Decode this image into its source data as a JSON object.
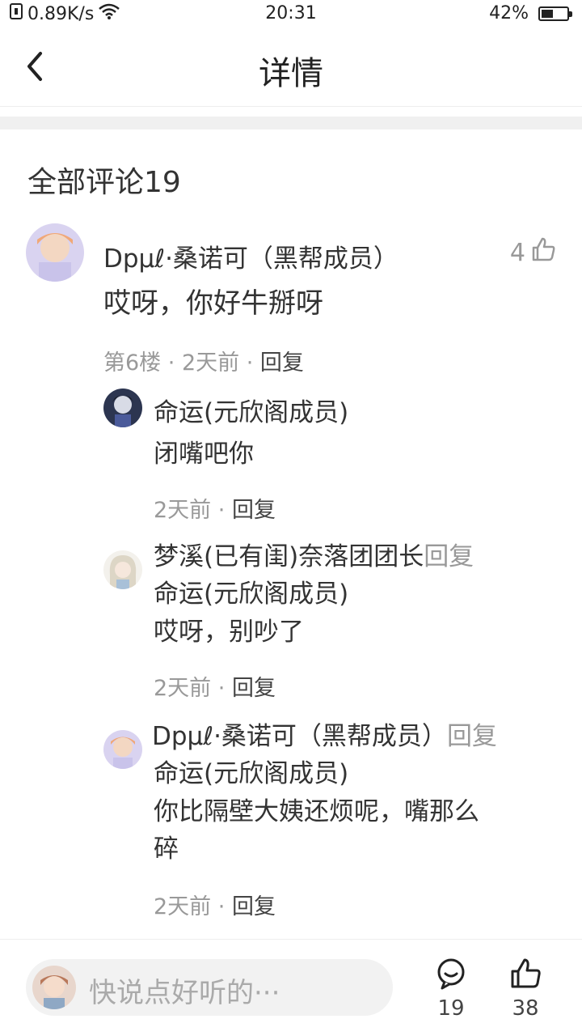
{
  "status_bar": {
    "net_speed": "0.89K/s",
    "time": "20:31",
    "battery": "42%",
    "battery_level": 0.42
  },
  "nav": {
    "title": "详情"
  },
  "section": {
    "title": "全部评论19"
  },
  "main_comment": {
    "author": "Dpμℓ·桑诺可（黑帮成员）",
    "likes": "4",
    "text": "哎呀，你好牛掰呀",
    "floor": "第6楼",
    "time": "2天前",
    "reply_label": "回复"
  },
  "replies": [
    {
      "author": "命运(元欣阁成员)",
      "text": "闭嘴吧你",
      "time": "2天前",
      "reply_label": "回复"
    },
    {
      "author": "梦溪(已有闺)奈落团团长",
      "reply_word": "回复",
      "target": "命运(元欣阁成员)",
      "text": "哎呀，别吵了",
      "time": "2天前",
      "reply_label": "回复"
    },
    {
      "author": "Dpμℓ·桑诺可（黑帮成员）",
      "reply_word": "回复",
      "target": "命运(元欣阁成员)",
      "text_line1": "你比隔壁大姨还烦呢，嘴那么",
      "text_line2": "碎",
      "time": "2天前",
      "reply_label": "回复"
    }
  ],
  "bottom_bar": {
    "placeholder": "快说点好听的···",
    "comment_count": "19",
    "like_count": "38"
  },
  "icons": {
    "back": "chevron-left-icon",
    "thumb": "thumb-up-icon",
    "chat": "chat-bubble-icon",
    "wifi": "wifi-icon",
    "battery": "battery-icon"
  }
}
